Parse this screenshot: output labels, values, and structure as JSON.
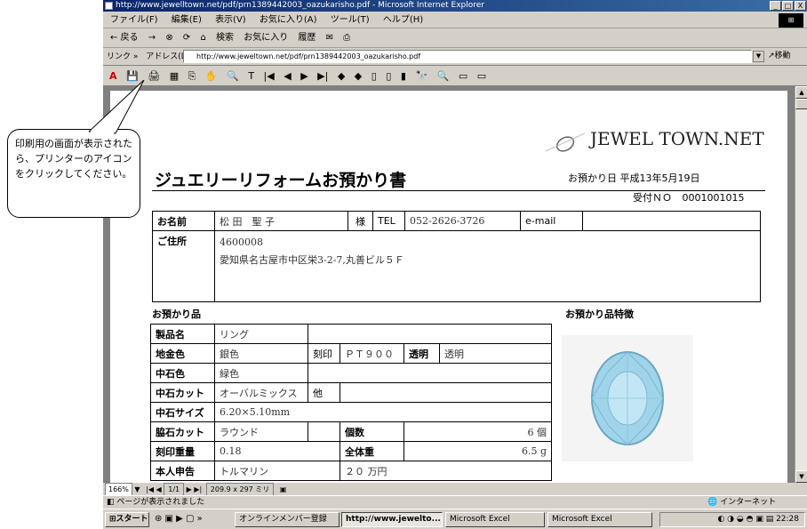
{
  "window": {
    "title": "http://www.jewelltown.net/pdf/prn1389442003_oazukarisho.pdf - Microsoft Internet Explorer",
    "min": "_",
    "max": "□",
    "close": "X"
  },
  "menu": [
    "ファイル(F)",
    "編集(E)",
    "表示(V)",
    "お気に入り(A)",
    "ツール(T)",
    "ヘルプ(H)"
  ],
  "toolbar": {
    "back": "← 戻る",
    "forward": "→",
    "stop": "⊗",
    "refresh": "⟳",
    "home": "⌂",
    "search": "検索",
    "favorites": "お気に入り",
    "history": "履歴",
    "mail": "✉",
    "print": "⎙"
  },
  "address": {
    "links_label": "リンク »",
    "label": "アドレス(D)",
    "url": "http://www.jeweltown.net/pdf/prn1389442003_oazukarisho.pdf",
    "go": "移動"
  },
  "pdf_toolbar": [
    "A",
    "💾",
    "🖨",
    "▦",
    "⎘",
    "✋",
    "🔍",
    "T",
    "|◀",
    "◀",
    "▶",
    "▶|",
    "◆",
    "◆",
    "▯",
    "▯",
    "▮",
    "🔭",
    "🔍",
    "▭",
    "▭"
  ],
  "callout": {
    "text": "印刷用の画面が表示されたら、プリンターのアイコンをクリックしてください。"
  },
  "document": {
    "brand": "JEWEL TOWN.NET",
    "title": "ジュエリーリフォームお預かり書",
    "date_label": "お預かり日",
    "date": "平成13年5月19日",
    "receipt_label": "受付ＮＯ",
    "receipt_no": "0001001015",
    "name_label": "お名前",
    "name": "松 田　聖 子",
    "honorific": "様",
    "tel_label": "TEL",
    "tel": "052-2626-3726",
    "email_label": "e-mail",
    "address_label": "ご住所",
    "postal": "4600008",
    "address": "愛知県名古屋市中区栄3-2-7,丸善ビル５Ｆ",
    "items_heading": "お預かり品",
    "features_heading": "お預かり品特徴",
    "rows": {
      "product_label": "製品名",
      "product": "リング",
      "metal_label": "地金色",
      "metal": "銀色",
      "stamp_label": "刻印",
      "stamp": "ＰＴ９００",
      "clarity_label": "透明",
      "clarity": "透明",
      "center_color_label": "中石色",
      "center_color": "緑色",
      "center_cut_label": "中石カット",
      "center_cut": "オーバルミックス",
      "other_label": "他",
      "center_size_label": "中石サイズ",
      "center_size": "6.20×5.10mm",
      "side_cut_label": "脇石カット",
      "side_cut": "ラウンド",
      "count_label": "個数",
      "count": "6 個",
      "stamp_weight_label": "刻印重量",
      "stamp_weight": "0.18",
      "total_weight_label": "全体重",
      "total_weight": "6.5 g",
      "declared_label": "本人申告",
      "declared": "トルマリン",
      "declared_value": "２０ 万円"
    }
  },
  "pdf_status": {
    "zoom": "166%",
    "page": "1/1",
    "size": "209.9 x 297 ミリ"
  },
  "ie_status": {
    "message": "ページが表示されました",
    "zone": "インターネット"
  },
  "taskbar": {
    "start": "スタート",
    "tasks": [
      "オンラインメンバー登録",
      "http://www.jewelto...",
      "Microsoft Excel",
      "Microsoft Excel"
    ],
    "clock": "22:28"
  }
}
